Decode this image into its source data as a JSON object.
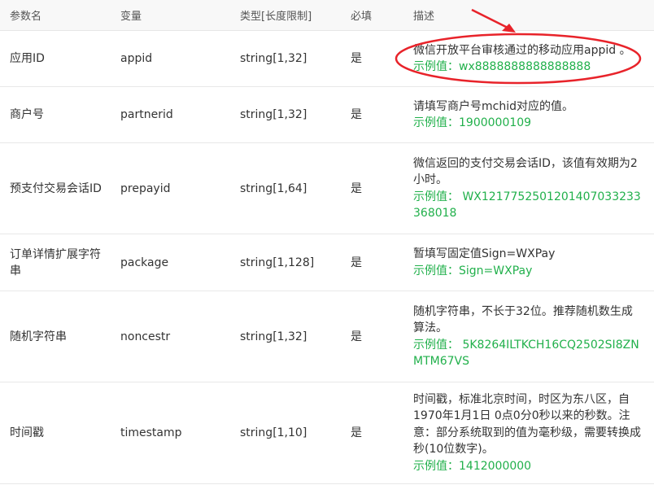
{
  "table": {
    "headers": {
      "name": "参数名",
      "variable": "变量",
      "type": "类型[长度限制]",
      "required": "必填",
      "description": "描述"
    },
    "rows": [
      {
        "name": "应用ID",
        "variable": "appid",
        "type": "string[1,32]",
        "required": "是",
        "description": "微信开放平台审核通过的移动应用appid 。",
        "example": "示例值：wx8888888888888888"
      },
      {
        "name": "商户号",
        "variable": "partnerid",
        "type": "string[1,32]",
        "required": "是",
        "description": "请填写商户号mchid对应的值。",
        "example": "示例值：1900000109"
      },
      {
        "name": "预支付交易会话ID",
        "variable": "prepayid",
        "type": "string[1,64]",
        "required": "是",
        "description": "微信返回的支付交易会话ID，该值有效期为2小时。",
        "example": "示例值： WX1217752501201407033233368018"
      },
      {
        "name": "订单详情扩展字符串",
        "variable": "package",
        "type": "string[1,128]",
        "required": "是",
        "description": "暂填写固定值Sign=WXPay",
        "example": "示例值：Sign=WXPay"
      },
      {
        "name": "随机字符串",
        "variable": "noncestr",
        "type": "string[1,32]",
        "required": "是",
        "description": "随机字符串，不长于32位。推荐随机数生成算法。",
        "example": "示例值： 5K8264ILTKCH16CQ2502SI8ZNMTM67VS"
      },
      {
        "name": "时间戳",
        "variable": "timestamp",
        "type": "string[1,10]",
        "required": "是",
        "description": "时间戳，标准北京时间，时区为东八区，自1970年1月1日 0点0分0秒以来的秒数。注意：部分系统取到的值为毫秒级，需要转换成秒(10位数字)。",
        "example": "示例值：1412000000"
      }
    ]
  },
  "annotation": {
    "color": "#e8232a"
  },
  "colors": {
    "example_text": "#21b04b",
    "header_bg": "#f8f8f8"
  }
}
